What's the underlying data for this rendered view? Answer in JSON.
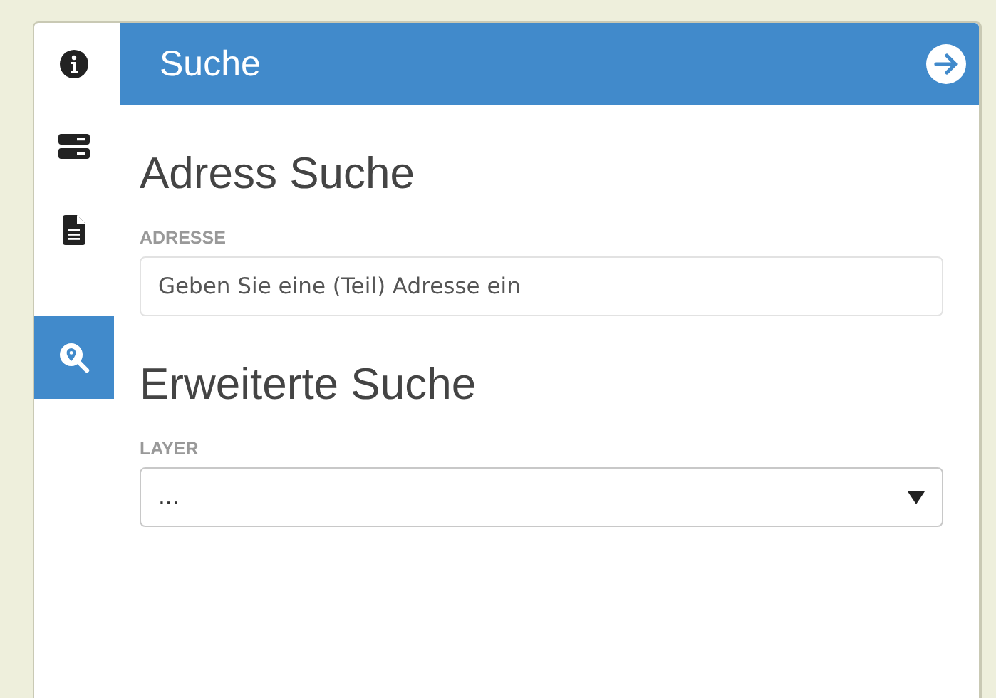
{
  "sidebar": {
    "items": [
      {
        "kind": "info",
        "selected": false
      },
      {
        "kind": "server",
        "selected": false
      },
      {
        "kind": "document",
        "selected": false
      },
      {
        "kind": "search",
        "selected": true
      }
    ]
  },
  "header": {
    "title": "Suche"
  },
  "sections": [
    {
      "heading": "Adress Suche",
      "field": {
        "kind": "input",
        "label": "ADRESSE",
        "placeholder": "Geben Sie eine (Teil) Adresse ein"
      }
    },
    {
      "heading": "Erweiterte Suche",
      "field": {
        "kind": "select",
        "label": "LAYER",
        "value": "..."
      }
    }
  ]
}
